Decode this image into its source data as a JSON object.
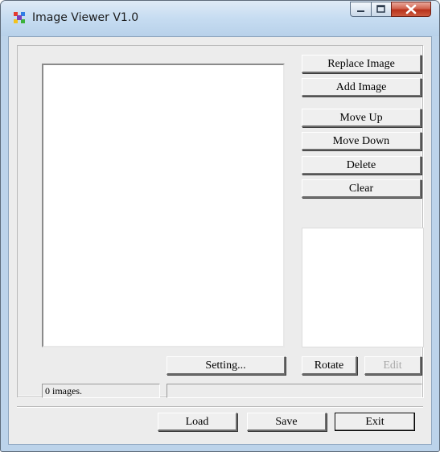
{
  "window": {
    "title": "Image Viewer V1.0",
    "icon": "colorful-pinwheel-icon",
    "controls": [
      "minimize-icon",
      "maximize-icon",
      "close-icon"
    ]
  },
  "right_panel": {
    "replace_label": "Replace Image",
    "add_label": "Add Image",
    "move_up_label": "Move Up",
    "move_down_label": "Move Down",
    "delete_label": "Delete",
    "clear_label": "Clear"
  },
  "row_buttons": {
    "setting_label": "Setting...",
    "rotate_label": "Rotate",
    "edit_label": "Edit"
  },
  "status": {
    "count_text": "0 images.",
    "detail_text": ""
  },
  "footer": {
    "load_label": "Load",
    "save_label": "Save",
    "exit_label": "Exit"
  },
  "colors": {
    "title_gradient_top": "#dfeaf6",
    "title_gradient_bottom": "#b8d1ea",
    "close_button": "#c74a34",
    "dialog_face": "#ececec"
  }
}
